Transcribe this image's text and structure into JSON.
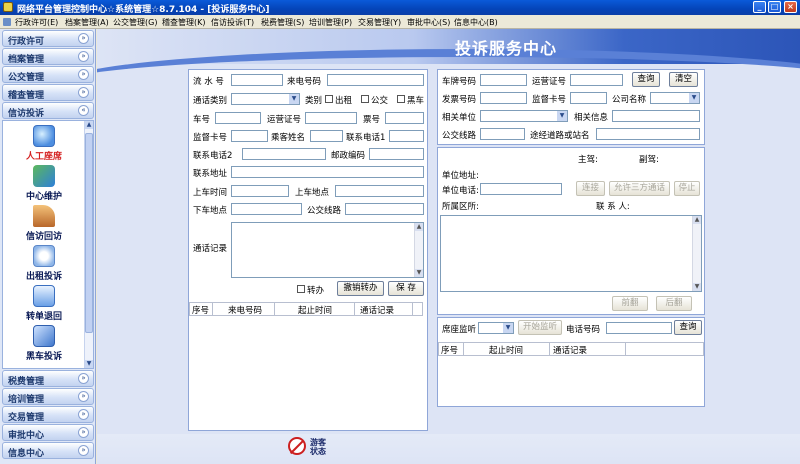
{
  "window": {
    "title": "网络平台管理控制中心☆系统管理☆8.7.104 - [投诉服务中心]",
    "minimize": "_",
    "restore": "□",
    "close": "×"
  },
  "menu": [
    "行政许可(E)",
    "档案管理(A)",
    "公交管理(G)",
    "稽查管理(K)",
    "信访投诉(T)",
    "税费管理(S)",
    "培训管理(P)",
    "交易管理(Y)",
    "审批中心(S)",
    "信息中心(B)"
  ],
  "sidebar": {
    "top_groups": [
      "行政许可",
      "档案管理",
      "公交管理",
      "稽查管理",
      "信访投诉"
    ],
    "items": [
      "人工座席",
      "中心维护",
      "信访回访",
      "出租投诉",
      "转单退回",
      "黑车投诉"
    ],
    "active_item": "人工座席",
    "bottom_groups": [
      "税费管理",
      "培训管理",
      "交易管理",
      "审批中心",
      "信息中心"
    ]
  },
  "banner": {
    "title": "投诉服务中心"
  },
  "left_form": {
    "serial_no": "流 水 号",
    "caller_no": "来电号码",
    "call_type": "通话类别",
    "category": "类别",
    "cb_taxi": "出租",
    "cb_bus": "公交",
    "cb_black": "黑车",
    "car_no": "车号",
    "ops_cert": "运营证号",
    "ticket_no": "票号",
    "supervisor_card": "监督卡号",
    "passenger_name": "乘客姓名",
    "phone1": "联系电话1",
    "phone2": "联系电话2",
    "postcode": "邮政编码",
    "address": "联系地址",
    "board_time": "上车时间",
    "board_place": "上车地点",
    "alight_place": "下车地点",
    "bus_route": "公交线路",
    "call_record": "通话记录",
    "transfer": "转办",
    "cancel_transfer_btn": "撤销转办",
    "save_btn": "保 存"
  },
  "left_grid": [
    "序号",
    "来电号码",
    "起止时间",
    "通话记录"
  ],
  "right_form": {
    "plate_no": "车牌号码",
    "ops_cert": "运营证号",
    "query_btn": "查询",
    "clear_btn": "清空",
    "invoice_no": "发票号码",
    "supervisor_card": "监督卡号",
    "company": "公司名称",
    "related_unit": "相关单位",
    "related_info": "相关信息",
    "bus_route": "公交线路",
    "via_station": "途经道路或站名"
  },
  "info_panel": {
    "main_driver": "主驾:",
    "co_driver": "副驾:",
    "unit_address": "单位地址:",
    "unit_phone": "单位电话:",
    "connect_btn": "连接",
    "three_way_btn": "允许三方通话",
    "stop_btn": "停止",
    "district": "所属区所:",
    "contact": "联 系 人:",
    "prev_btn": "前翻",
    "next_btn": "后翻"
  },
  "monitor": {
    "seat_monitor": "席座监听",
    "start_btn": "开始监听",
    "phone_no": "电话号码",
    "query_btn": "查询"
  },
  "right_grid": [
    "序号",
    "起止时间",
    "通话记录"
  ],
  "status": {
    "text": "游客状态"
  },
  "colors": {
    "title_bar": "#0444b8",
    "banner": "#2c55b8",
    "active_item": "#d42020"
  }
}
